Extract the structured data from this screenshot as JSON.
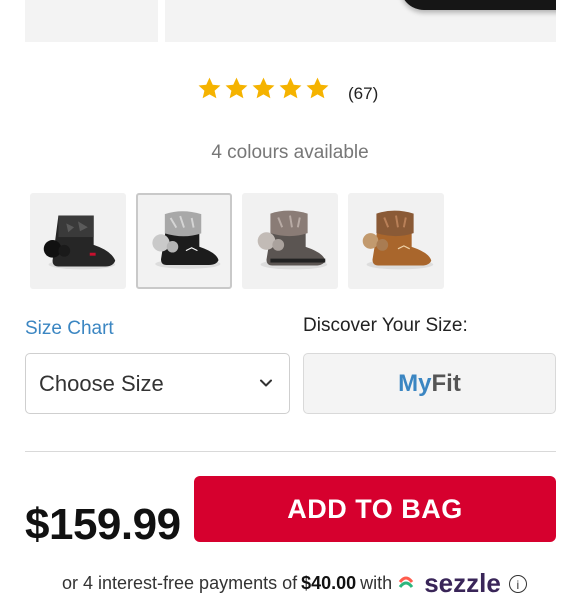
{
  "rating": {
    "stars": 5,
    "review_count": "(67)"
  },
  "colours_available": "4 colours available",
  "swatches": [
    {
      "name": "black",
      "selected": false
    },
    {
      "name": "black-grey-fur",
      "selected": true
    },
    {
      "name": "grey",
      "selected": false
    },
    {
      "name": "tan",
      "selected": false
    }
  ],
  "size": {
    "chart_link": "Size Chart",
    "discover_label": "Discover Your Size:",
    "select_label": "Choose Size",
    "myfit_my": "My",
    "myfit_fit": "Fit"
  },
  "purchase": {
    "price": "$159.99",
    "add_to_bag": "ADD TO BAG"
  },
  "installments": {
    "prefix": "or 4 interest-free payments of",
    "amount": "$40.00",
    "suffix": "with",
    "provider": "sezzle"
  },
  "colors": {
    "accent_red": "#d6002e",
    "link_blue": "#3b86c2",
    "star_gold": "#f5b300"
  }
}
